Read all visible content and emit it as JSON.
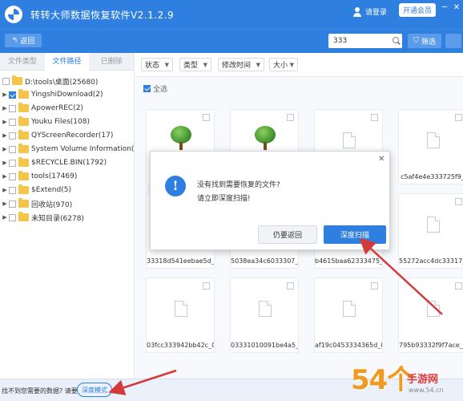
{
  "app": {
    "title": "转转大师数据恢复软件V2.1.2.9",
    "login_label": "请登录",
    "vip_label": "开通会员",
    "accent_color": "#2e7fe0",
    "brand_icon": "logo-icon",
    "window_controls": [
      "─",
      "✕"
    ]
  },
  "toolbar": {
    "back_label": "返回",
    "search_value": "333",
    "filter_label": "筛选"
  },
  "sidebar": {
    "tabs": [
      "文件类型",
      "文件路径",
      "已删除"
    ],
    "active_tab": "文件路径",
    "root": "D:\\tools\\桌面(25680)",
    "items": [
      {
        "label": "YingshiDownload(2)",
        "checked": true
      },
      {
        "label": "ApowerREC(2)",
        "checked": false
      },
      {
        "label": "Youku Files(108)",
        "checked": false
      },
      {
        "label": "QYScreenRecorder(17)",
        "checked": false
      },
      {
        "label": "System Volume Information(3)",
        "checked": false
      },
      {
        "label": "$RECYCLE.BIN(1792)",
        "checked": false
      },
      {
        "label": "tools(17469)",
        "checked": false
      },
      {
        "label": "$Extend(5)",
        "checked": false
      },
      {
        "label": "回收站(970)",
        "checked": false
      },
      {
        "label": "未知目录(6278)",
        "checked": false
      }
    ]
  },
  "filters": {
    "status": "状态",
    "type": "类型",
    "modified": "修改时间",
    "size": "大小",
    "select_all": "全选"
  },
  "files": [
    {
      "name": "",
      "kind": "tree"
    },
    {
      "name": "",
      "kind": "tree"
    },
    {
      "name": "",
      "kind": "doc"
    },
    {
      "name": "c5af4e4e333725f9_",
      "kind": "doc"
    },
    {
      "name": "33318d541eebae5d_0",
      "kind": "doc"
    },
    {
      "name": "5038ea34c6033307_0",
      "kind": "doc"
    },
    {
      "name": "b4615baa62333475_0",
      "kind": "doc"
    },
    {
      "name": "55272acc4dc33317_0",
      "kind": "doc"
    },
    {
      "name": "03fcc333942bb42c_0",
      "kind": "doc"
    },
    {
      "name": "03331010091be4a5_0",
      "kind": "doc"
    },
    {
      "name": "af19c0453334365d_0",
      "kind": "doc"
    },
    {
      "name": "795b93332f9f7ace_0",
      "kind": "doc"
    }
  ],
  "dialog": {
    "message_line1": "没有找到需要恢复的文件?",
    "message_line2": "请立即深度扫描!",
    "cancel_label": "仍要返回",
    "confirm_label": "深度扫描",
    "close_icon": "✕",
    "info_glyph": "!"
  },
  "bottom": {
    "hint": "找不到您需要的数据? 请要",
    "deep_mode_label": "深度模式"
  },
  "watermark": {
    "number": "54个",
    "site": "手游网",
    "url": "www.54.cn"
  }
}
